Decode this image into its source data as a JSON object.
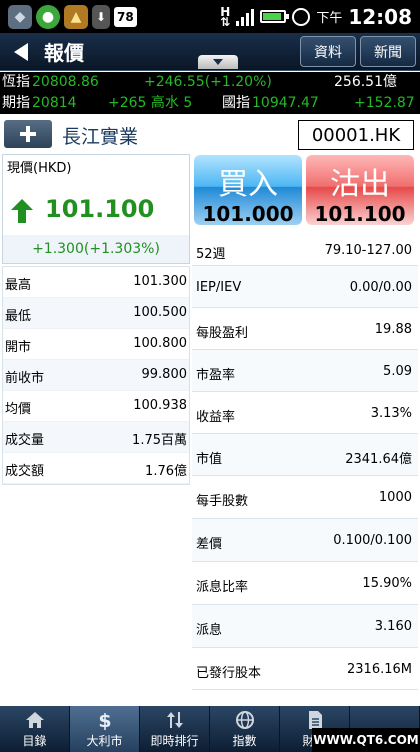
{
  "status_bar": {
    "badge": "78",
    "ampm": "下午",
    "time": "12:08",
    "net": "H",
    "battery_level": 0.9
  },
  "header": {
    "title": "報價",
    "info_label": "資料",
    "news_label": "新聞"
  },
  "ticker": {
    "row1": {
      "label": "恆指",
      "value": "20808.86",
      "change": "+246.55(+1.20%)",
      "turnover": "256.51億"
    },
    "row2": {
      "label": "期指",
      "value": "20814",
      "change": "+265 高水 5",
      "label2": "國指",
      "value2": "10947.47",
      "change2": "+152.87"
    }
  },
  "stock": {
    "name": "長江實業",
    "code": "00001.HK"
  },
  "price": {
    "label": "現價(HKD)",
    "value": "101.100",
    "change": "+1.300(+1.303%)"
  },
  "trade": {
    "buy_label": "買入",
    "buy_price": "101.000",
    "sell_label": "沽出",
    "sell_price": "101.100"
  },
  "left_stats": [
    {
      "label": "最高",
      "value": "101.300"
    },
    {
      "label": "最低",
      "value": "100.500"
    },
    {
      "label": "開市",
      "value": "100.800"
    },
    {
      "label": "前收市",
      "value": "99.800"
    },
    {
      "label": "均價",
      "value": "100.938"
    },
    {
      "label": "成交量",
      "value": "1.75百萬"
    },
    {
      "label": "成交額",
      "value": "1.76億"
    }
  ],
  "right_stats": [
    {
      "label": "52週",
      "value": "79.10-127.00"
    },
    {
      "label": "IEP/IEV",
      "value": "0.00/0.00"
    },
    {
      "label": "每股盈利",
      "value": "19.88"
    },
    {
      "label": "市盈率",
      "value": "5.09"
    },
    {
      "label": "收益率",
      "value": "3.13%"
    },
    {
      "label": "市值",
      "value": "2341.64億"
    },
    {
      "label": "每手股數",
      "value": "1000"
    },
    {
      "label": "差價",
      "value": "0.100/0.100"
    },
    {
      "label": "派息比率",
      "value": "15.90%"
    },
    {
      "label": "派息",
      "value": "3.160"
    },
    {
      "label": "已發行股本",
      "value": "2316.16M"
    }
  ],
  "bottom_nav": [
    {
      "label": "目錄",
      "icon": "home-icon"
    },
    {
      "label": "大利市",
      "icon": "dollar-icon"
    },
    {
      "label": "即時排行",
      "icon": "sort-icon"
    },
    {
      "label": "指數",
      "icon": "globe-icon"
    },
    {
      "label": "財經",
      "icon": "document-icon"
    },
    {
      "label": "",
      "icon": "dollar-icon"
    }
  ],
  "watermark": "WWW.QT6.COM",
  "colors": {
    "up_green": "#219021",
    "buy_blue": "#1f8ad6",
    "sell_red": "#e74949",
    "header_navy": "#1a2f4a"
  }
}
